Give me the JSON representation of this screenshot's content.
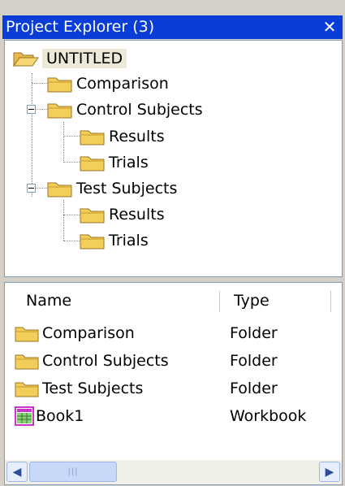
{
  "window": {
    "title": "Project Explorer (3)",
    "close_glyph": "✕"
  },
  "tree": {
    "root": "UNTITLED",
    "items": [
      {
        "label": "Comparison",
        "icon": "folder-icon"
      },
      {
        "label": "Control Subjects",
        "icon": "folder-icon",
        "expanded": true
      },
      {
        "label": "Results",
        "icon": "folder-icon"
      },
      {
        "label": "Trials",
        "icon": "folder-icon"
      },
      {
        "label": "Test Subjects",
        "icon": "folder-icon",
        "expanded": true
      },
      {
        "label": "Results",
        "icon": "folder-icon"
      },
      {
        "label": "Trials",
        "icon": "folder-icon"
      }
    ]
  },
  "list": {
    "columns": {
      "name": "Name",
      "type": "Type"
    },
    "rows": [
      {
        "name": "Comparison",
        "type": "Folder",
        "icon": "folder-icon"
      },
      {
        "name": "Control Subjects",
        "type": "Folder",
        "icon": "folder-icon"
      },
      {
        "name": "Test Subjects",
        "type": "Folder",
        "icon": "folder-icon"
      },
      {
        "name": "Book1",
        "type": "Workbook",
        "icon": "workbook-icon"
      }
    ]
  },
  "scrollbar": {
    "left_glyph": "◀",
    "right_glyph": "▶",
    "grip": "|||"
  },
  "colors": {
    "titlebar": "#0a3cd7",
    "folder": "#f2cf5b",
    "workbook": "#cc33cc"
  }
}
